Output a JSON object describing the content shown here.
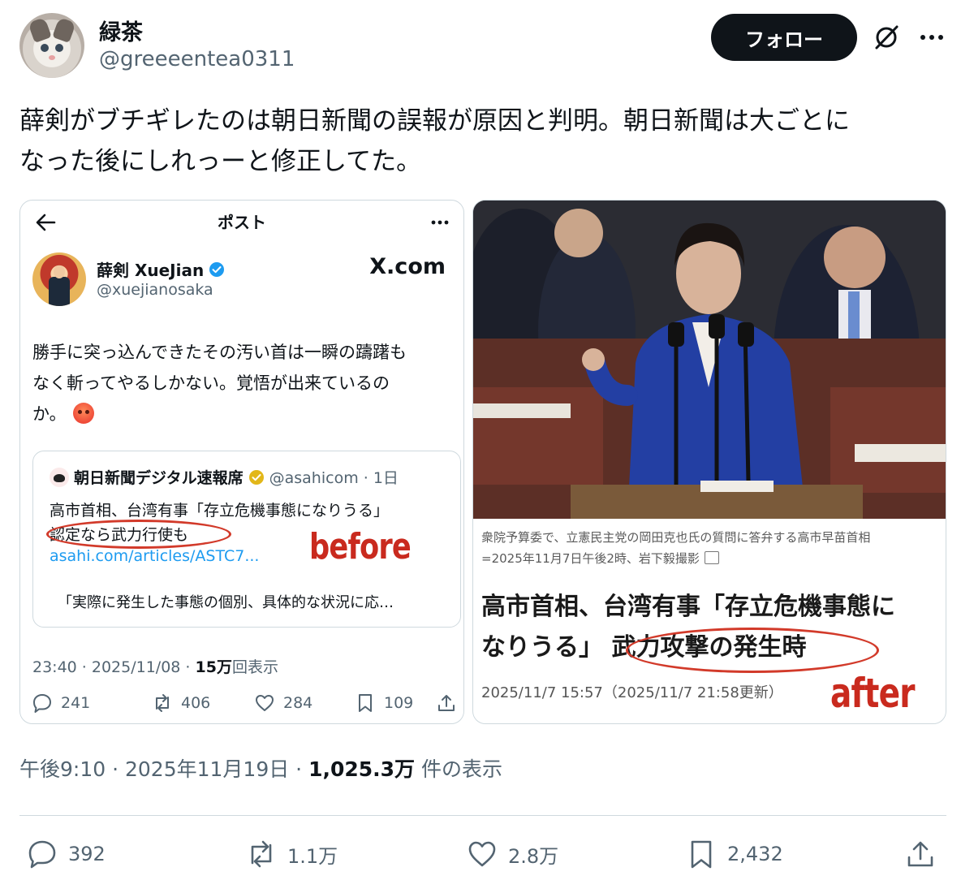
{
  "author": {
    "display_name": "緑茶",
    "handle": "@greeeentea0311"
  },
  "header": {
    "follow_label": "フォロー",
    "icons": [
      "grok-icon",
      "more-icon"
    ]
  },
  "tweet": {
    "text_line1": "薛剣がブチギレたのは朝日新聞の誤報が原因と判明。朝日新聞は大ごとに",
    "text_line2": "なった後にしれっーと修正してた。",
    "meta_time": "午後9:10 · 2025年11月19日 · ",
    "meta_views": "1,025.3万",
    "meta_views_suffix": " 件の表示"
  },
  "embedded_left": {
    "header_title": "ポスト",
    "author_name": "薛剣 XueJian",
    "author_handle": "@xuejianosaka",
    "site": "X.com",
    "text_line1": "勝手に突っ込んできたその汚い首は一瞬の躊躇も",
    "text_line2": "なく斬ってやるしかない。覚悟が出来ているの",
    "text_line3": "か。",
    "quote": {
      "name": "朝日新聞デジタル速報席",
      "handle_time": "@asahicom · 1日",
      "line1": "高市首相、台湾有事「存立危機事態になりうる」",
      "line2": "認定なら武力行使も",
      "link": "asahi.com/articles/ASTC7...",
      "excerpt": "「実際に発生した事態の個別、具体的な状況に応…"
    },
    "annotation": "before",
    "meta_time": "23:40 · 2025/11/08 · ",
    "meta_views": "15万",
    "meta_views_suffix": "回表示",
    "actions": {
      "replies": "241",
      "reposts": "406",
      "likes": "284",
      "bookmarks": "109"
    }
  },
  "embedded_right": {
    "caption_line1": "衆院予算委で、立憲民主党の岡田克也氏の質問に答弁する高市早苗首相",
    "caption_line2": "=2025年11月7日午後2時、岩下毅撮影",
    "headline_line1": "高市首相、台湾有事「存立危機事態に",
    "headline_line2": "なりうる」 武力攻撃の発生時",
    "date": "2025/11/7 15:57（2025/11/7 21:58更新）",
    "annotation": "after"
  },
  "actions": {
    "replies": "392",
    "reposts": "1.1万",
    "likes": "2.8万",
    "bookmarks": "2,432"
  },
  "colors": {
    "text": "#0f1419",
    "muted": "#536471",
    "link": "#1d9bf0",
    "annotation_red": "#c92a1e",
    "follow_bg": "#0f1419"
  }
}
